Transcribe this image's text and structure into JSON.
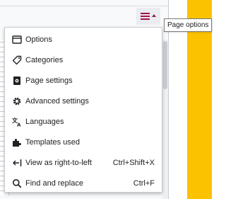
{
  "tooltip": {
    "text": "Page options"
  },
  "menu": {
    "items": [
      {
        "label": "Options",
        "icon": "window-icon",
        "shortcut": ""
      },
      {
        "label": "Categories",
        "icon": "tag-icon",
        "shortcut": ""
      },
      {
        "label": "Page settings",
        "icon": "page-settings-icon",
        "shortcut": ""
      },
      {
        "label": "Advanced settings",
        "icon": "gear-icon",
        "shortcut": ""
      },
      {
        "label": "Languages",
        "icon": "language-icon",
        "shortcut": ""
      },
      {
        "label": "Templates used",
        "icon": "puzzle-icon",
        "shortcut": ""
      },
      {
        "label": "View as right-to-left",
        "icon": "rtl-icon",
        "shortcut": "Ctrl+Shift+X"
      },
      {
        "label": "Find and replace",
        "icon": "search-icon",
        "shortcut": "Ctrl+F"
      }
    ]
  },
  "colors": {
    "accent": "#a2134b",
    "side_strip": "#fbc200",
    "text": "#202122"
  }
}
